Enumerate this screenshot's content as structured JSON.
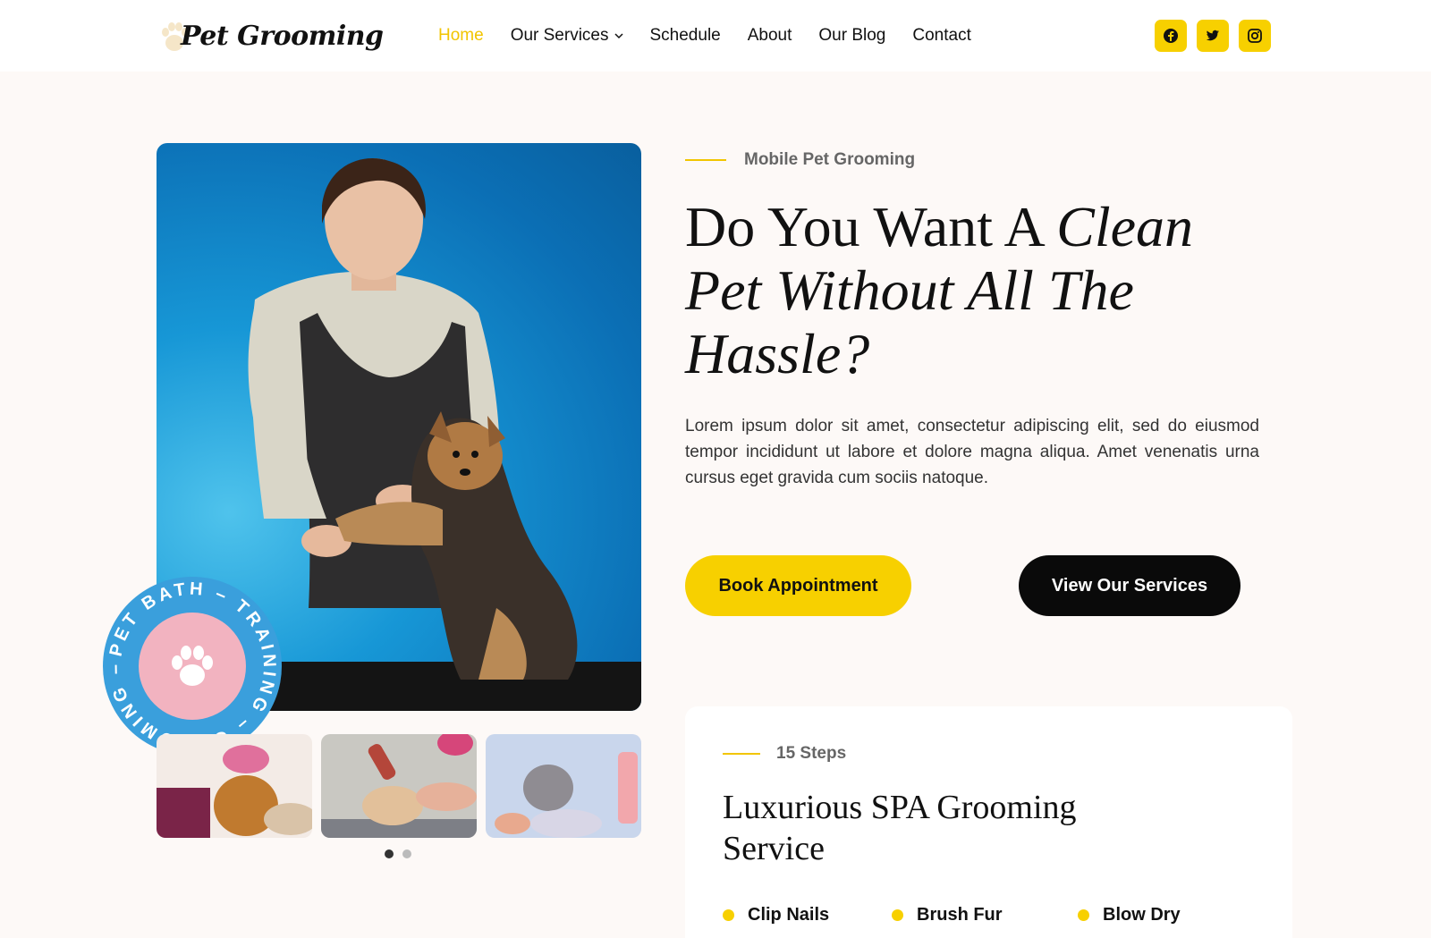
{
  "header": {
    "logo_text": "Pet Grooming",
    "nav": [
      {
        "label": "Home",
        "active": true
      },
      {
        "label": "Our Services",
        "has_dropdown": true
      },
      {
        "label": "Schedule"
      },
      {
        "label": "About"
      },
      {
        "label": "Our Blog"
      },
      {
        "label": "Contact"
      }
    ],
    "socials": [
      {
        "icon": "facebook-icon"
      },
      {
        "icon": "twitter-icon"
      },
      {
        "icon": "instagram-icon"
      }
    ]
  },
  "colors": {
    "accent": "#f7d000",
    "dark": "#0a0a0a",
    "background": "#fdf9f7",
    "badge_blue": "#3a9fdc",
    "badge_pink": "#f2b3c0"
  },
  "hero": {
    "badge_text": "PET BATH – TRAINING – GROOMING –",
    "badge_icon": "paw-icon",
    "slider_total": 2,
    "slider_active": 1
  },
  "content": {
    "eyebrow": "Mobile Pet Grooming",
    "headline_plain": "Do You Want A ",
    "headline_italic": "Clean Pet Without All The Hassle?",
    "paragraph": "Lorem ipsum dolor sit amet, consectetur adipiscing elit, sed do eiusmod tempor incididunt ut labore et dolore magna aliqua. Amet venenatis urna cursus eget gravida cum sociis natoque.",
    "primary_button": "Book Appointment",
    "secondary_button": "View Our Services"
  },
  "card": {
    "eyebrow": "15 Steps",
    "title": "Luxurious SPA Grooming Service",
    "features": [
      "Clip Nails",
      "Brush Fur",
      "Blow Dry"
    ]
  }
}
